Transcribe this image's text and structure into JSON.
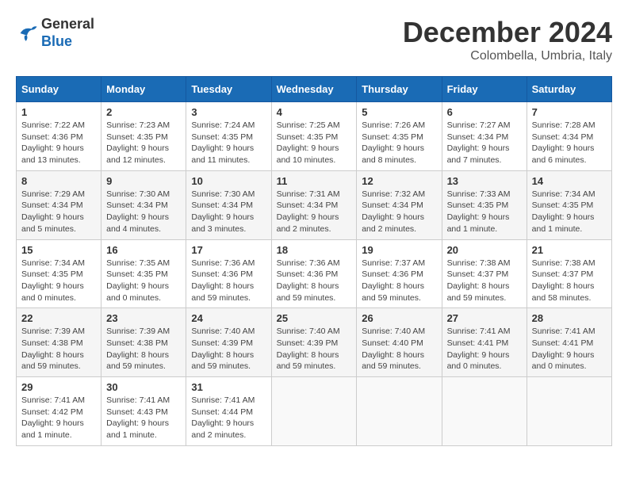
{
  "logo": {
    "general": "General",
    "blue": "Blue"
  },
  "title": {
    "month": "December 2024",
    "location": "Colombella, Umbria, Italy"
  },
  "calendar": {
    "headers": [
      "Sunday",
      "Monday",
      "Tuesday",
      "Wednesday",
      "Thursday",
      "Friday",
      "Saturday"
    ],
    "weeks": [
      [
        {
          "day": "1",
          "sunrise": "Sunrise: 7:22 AM",
          "sunset": "Sunset: 4:36 PM",
          "daylight": "Daylight: 9 hours and 13 minutes."
        },
        {
          "day": "2",
          "sunrise": "Sunrise: 7:23 AM",
          "sunset": "Sunset: 4:35 PM",
          "daylight": "Daylight: 9 hours and 12 minutes."
        },
        {
          "day": "3",
          "sunrise": "Sunrise: 7:24 AM",
          "sunset": "Sunset: 4:35 PM",
          "daylight": "Daylight: 9 hours and 11 minutes."
        },
        {
          "day": "4",
          "sunrise": "Sunrise: 7:25 AM",
          "sunset": "Sunset: 4:35 PM",
          "daylight": "Daylight: 9 hours and 10 minutes."
        },
        {
          "day": "5",
          "sunrise": "Sunrise: 7:26 AM",
          "sunset": "Sunset: 4:35 PM",
          "daylight": "Daylight: 9 hours and 8 minutes."
        },
        {
          "day": "6",
          "sunrise": "Sunrise: 7:27 AM",
          "sunset": "Sunset: 4:34 PM",
          "daylight": "Daylight: 9 hours and 7 minutes."
        },
        {
          "day": "7",
          "sunrise": "Sunrise: 7:28 AM",
          "sunset": "Sunset: 4:34 PM",
          "daylight": "Daylight: 9 hours and 6 minutes."
        }
      ],
      [
        {
          "day": "8",
          "sunrise": "Sunrise: 7:29 AM",
          "sunset": "Sunset: 4:34 PM",
          "daylight": "Daylight: 9 hours and 5 minutes."
        },
        {
          "day": "9",
          "sunrise": "Sunrise: 7:30 AM",
          "sunset": "Sunset: 4:34 PM",
          "daylight": "Daylight: 9 hours and 4 minutes."
        },
        {
          "day": "10",
          "sunrise": "Sunrise: 7:30 AM",
          "sunset": "Sunset: 4:34 PM",
          "daylight": "Daylight: 9 hours and 3 minutes."
        },
        {
          "day": "11",
          "sunrise": "Sunrise: 7:31 AM",
          "sunset": "Sunset: 4:34 PM",
          "daylight": "Daylight: 9 hours and 2 minutes."
        },
        {
          "day": "12",
          "sunrise": "Sunrise: 7:32 AM",
          "sunset": "Sunset: 4:34 PM",
          "daylight": "Daylight: 9 hours and 2 minutes."
        },
        {
          "day": "13",
          "sunrise": "Sunrise: 7:33 AM",
          "sunset": "Sunset: 4:35 PM",
          "daylight": "Daylight: 9 hours and 1 minute."
        },
        {
          "day": "14",
          "sunrise": "Sunrise: 7:34 AM",
          "sunset": "Sunset: 4:35 PM",
          "daylight": "Daylight: 9 hours and 1 minute."
        }
      ],
      [
        {
          "day": "15",
          "sunrise": "Sunrise: 7:34 AM",
          "sunset": "Sunset: 4:35 PM",
          "daylight": "Daylight: 9 hours and 0 minutes."
        },
        {
          "day": "16",
          "sunrise": "Sunrise: 7:35 AM",
          "sunset": "Sunset: 4:35 PM",
          "daylight": "Daylight: 9 hours and 0 minutes."
        },
        {
          "day": "17",
          "sunrise": "Sunrise: 7:36 AM",
          "sunset": "Sunset: 4:36 PM",
          "daylight": "Daylight: 8 hours and 59 minutes."
        },
        {
          "day": "18",
          "sunrise": "Sunrise: 7:36 AM",
          "sunset": "Sunset: 4:36 PM",
          "daylight": "Daylight: 8 hours and 59 minutes."
        },
        {
          "day": "19",
          "sunrise": "Sunrise: 7:37 AM",
          "sunset": "Sunset: 4:36 PM",
          "daylight": "Daylight: 8 hours and 59 minutes."
        },
        {
          "day": "20",
          "sunrise": "Sunrise: 7:38 AM",
          "sunset": "Sunset: 4:37 PM",
          "daylight": "Daylight: 8 hours and 59 minutes."
        },
        {
          "day": "21",
          "sunrise": "Sunrise: 7:38 AM",
          "sunset": "Sunset: 4:37 PM",
          "daylight": "Daylight: 8 hours and 58 minutes."
        }
      ],
      [
        {
          "day": "22",
          "sunrise": "Sunrise: 7:39 AM",
          "sunset": "Sunset: 4:38 PM",
          "daylight": "Daylight: 8 hours and 59 minutes."
        },
        {
          "day": "23",
          "sunrise": "Sunrise: 7:39 AM",
          "sunset": "Sunset: 4:38 PM",
          "daylight": "Daylight: 8 hours and 59 minutes."
        },
        {
          "day": "24",
          "sunrise": "Sunrise: 7:40 AM",
          "sunset": "Sunset: 4:39 PM",
          "daylight": "Daylight: 8 hours and 59 minutes."
        },
        {
          "day": "25",
          "sunrise": "Sunrise: 7:40 AM",
          "sunset": "Sunset: 4:39 PM",
          "daylight": "Daylight: 8 hours and 59 minutes."
        },
        {
          "day": "26",
          "sunrise": "Sunrise: 7:40 AM",
          "sunset": "Sunset: 4:40 PM",
          "daylight": "Daylight: 8 hours and 59 minutes."
        },
        {
          "day": "27",
          "sunrise": "Sunrise: 7:41 AM",
          "sunset": "Sunset: 4:41 PM",
          "daylight": "Daylight: 9 hours and 0 minutes."
        },
        {
          "day": "28",
          "sunrise": "Sunrise: 7:41 AM",
          "sunset": "Sunset: 4:41 PM",
          "daylight": "Daylight: 9 hours and 0 minutes."
        }
      ],
      [
        {
          "day": "29",
          "sunrise": "Sunrise: 7:41 AM",
          "sunset": "Sunset: 4:42 PM",
          "daylight": "Daylight: 9 hours and 1 minute."
        },
        {
          "day": "30",
          "sunrise": "Sunrise: 7:41 AM",
          "sunset": "Sunset: 4:43 PM",
          "daylight": "Daylight: 9 hours and 1 minute."
        },
        {
          "day": "31",
          "sunrise": "Sunrise: 7:41 AM",
          "sunset": "Sunset: 4:44 PM",
          "daylight": "Daylight: 9 hours and 2 minutes."
        },
        null,
        null,
        null,
        null
      ]
    ]
  }
}
